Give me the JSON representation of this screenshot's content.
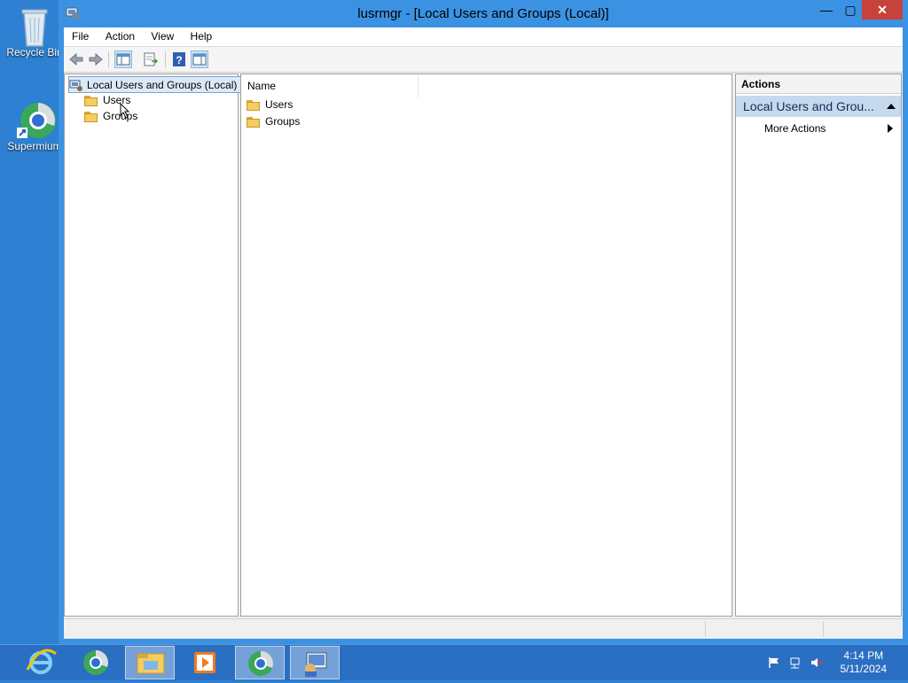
{
  "desktop": {
    "icons": [
      {
        "label": "Recycle Bin",
        "icon": "recycle-bin-icon"
      },
      {
        "label": "Supermium",
        "icon": "browser-icon"
      }
    ]
  },
  "window": {
    "title": "lusrmgr - [Local Users and Groups (Local)]",
    "controls": {
      "minimize": "—",
      "maximize": "▢",
      "close": "✕"
    }
  },
  "menu": [
    "File",
    "Action",
    "View",
    "Help"
  ],
  "toolbar": {
    "buttons": [
      "back-icon",
      "forward-icon",
      "show-hide-tree-icon",
      "export-list-icon",
      "help-icon",
      "show-hide-action-pane-icon"
    ]
  },
  "tree": {
    "root": "Local Users and Groups (Local)",
    "children": [
      "Users",
      "Groups"
    ]
  },
  "list": {
    "column": "Name",
    "items": [
      "Users",
      "Groups"
    ]
  },
  "actions": {
    "header": "Actions",
    "section": "Local Users and Grou...",
    "more": "More Actions"
  },
  "taskbar": {
    "time": "4:14 PM",
    "date": "5/11/2024"
  },
  "colors": {
    "desktop": "#2d80d2",
    "window_frame": "#3c92e2",
    "close_button": "#c7423a",
    "selection": "#c7d9ee"
  }
}
